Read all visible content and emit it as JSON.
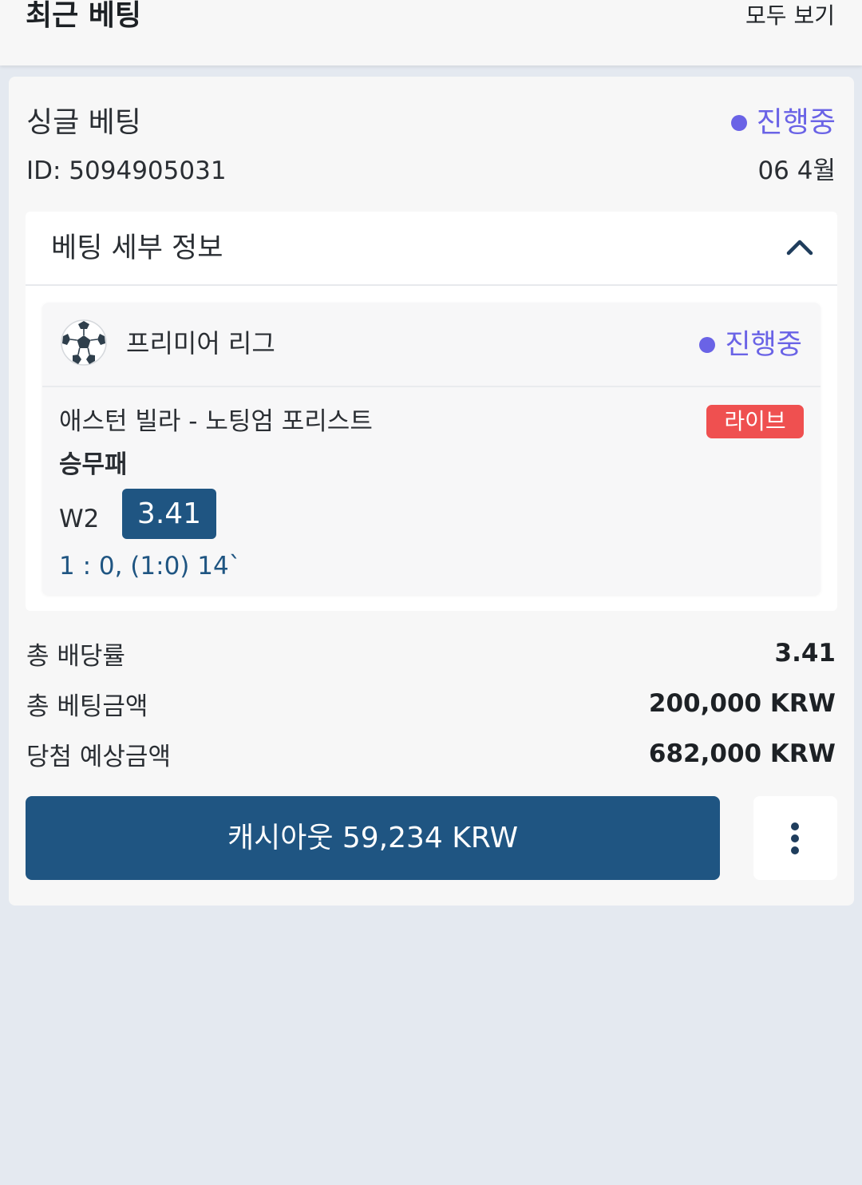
{
  "header": {
    "title": "최근 베팅",
    "view_all": "모두 보기"
  },
  "bet": {
    "type": "싱글 베팅",
    "status": "진행중",
    "id": "ID: 5094905031",
    "date": "06 4월",
    "details_label": "베팅 세부 정보",
    "event": {
      "sport_icon": "soccer-ball-icon",
      "league": "프리미어 리그",
      "status": "진행중",
      "match": "애스턴 빌라 - 노팅엄 포리스트",
      "live_badge": "라이브",
      "market": "승무패",
      "selection": "W2",
      "odds": "3.41",
      "score": "1 : 0, (1:0) 14`"
    },
    "summary": {
      "total_odds_label": "총 배당률",
      "total_odds_value": "3.41",
      "total_stake_label": "총 베팅금액",
      "total_stake_value": "200,000 KRW",
      "potential_win_label": "당첨 예상금액",
      "potential_win_value": "682,000 KRW"
    },
    "cashout_label": "캐시아웃 59,234 KRW",
    "more_icon": "more-vertical-icon"
  },
  "colors": {
    "accent_blue": "#1f5582",
    "status_purple": "#6a63e6",
    "live_red": "#ef5050",
    "page_bg": "#e4e9f0"
  }
}
